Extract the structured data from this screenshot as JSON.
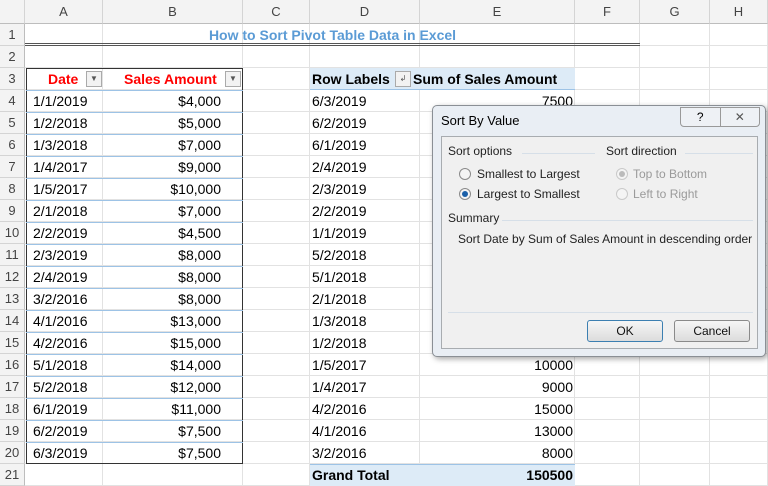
{
  "columns": [
    "A",
    "B",
    "C",
    "D",
    "E",
    "F",
    "G",
    "H"
  ],
  "rows": [
    "1",
    "2",
    "3",
    "4",
    "5",
    "6",
    "7",
    "8",
    "9",
    "10",
    "11",
    "12",
    "13",
    "14",
    "15",
    "16",
    "17",
    "18",
    "19",
    "20",
    "21"
  ],
  "title": "How to Sort Pivot Table Data in Excel",
  "source_table": {
    "headers": [
      "Date",
      "Sales Amount"
    ],
    "rows": [
      [
        "1/1/2019",
        "$4,000"
      ],
      [
        "1/2/2018",
        "$5,000"
      ],
      [
        "1/3/2018",
        "$7,000"
      ],
      [
        "1/4/2017",
        "$9,000"
      ],
      [
        "1/5/2017",
        "$10,000"
      ],
      [
        "2/1/2018",
        "$7,000"
      ],
      [
        "2/2/2019",
        "$4,500"
      ],
      [
        "2/3/2019",
        "$8,000"
      ],
      [
        "2/4/2019",
        "$8,000"
      ],
      [
        "3/2/2016",
        "$8,000"
      ],
      [
        "4/1/2016",
        "$13,000"
      ],
      [
        "4/2/2016",
        "$15,000"
      ],
      [
        "5/1/2018",
        "$14,000"
      ],
      [
        "5/2/2018",
        "$12,000"
      ],
      [
        "6/1/2019",
        "$11,000"
      ],
      [
        "6/2/2019",
        "$7,500"
      ],
      [
        "6/3/2019",
        "$7,500"
      ]
    ]
  },
  "pivot": {
    "headers": [
      "Row Labels",
      "Sum of Sales Amount"
    ],
    "rows": [
      [
        "6/3/2019",
        "7500"
      ],
      [
        "6/2/2019",
        ""
      ],
      [
        "6/1/2019",
        ""
      ],
      [
        "2/4/2019",
        ""
      ],
      [
        "2/3/2019",
        ""
      ],
      [
        "2/2/2019",
        ""
      ],
      [
        "1/1/2019",
        ""
      ],
      [
        "5/2/2018",
        ""
      ],
      [
        "5/1/2018",
        ""
      ],
      [
        "2/1/2018",
        ""
      ],
      [
        "1/3/2018",
        ""
      ],
      [
        "1/2/2018",
        ""
      ],
      [
        "1/5/2017",
        "10000"
      ],
      [
        "1/4/2017",
        "9000"
      ],
      [
        "4/2/2016",
        "15000"
      ],
      [
        "4/1/2016",
        "13000"
      ],
      [
        "3/2/2016",
        "8000"
      ]
    ],
    "total_label": "Grand Total",
    "total_value": "150500"
  },
  "dialog": {
    "title": "Sort By Value",
    "help": "?",
    "close": "✕",
    "sort_options_label": "Sort options",
    "sort_options": [
      "Smallest to Largest",
      "Largest to Smallest"
    ],
    "selected_option": 1,
    "sort_direction_label": "Sort direction",
    "sort_directions": [
      "Top to Bottom",
      "Left to Right"
    ],
    "summary_label": "Summary",
    "summary_text": "Sort Date by Sum of Sales Amount in descending order",
    "ok": "OK",
    "cancel": "Cancel"
  }
}
